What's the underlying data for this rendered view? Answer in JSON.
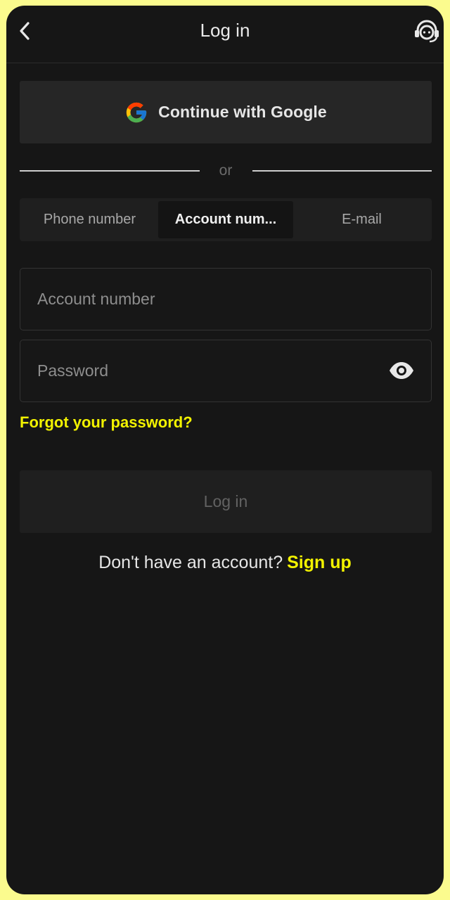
{
  "header": {
    "title": "Log in",
    "back_icon": "chevron-left-icon",
    "support_icon": "headset-support-icon"
  },
  "google": {
    "label": "Continue with Google",
    "icon": "google-g-icon"
  },
  "divider": {
    "text": "or"
  },
  "tabs": [
    {
      "label": "Phone number",
      "active": false
    },
    {
      "label": "Account num...",
      "active": true
    },
    {
      "label": "E-mail",
      "active": false
    }
  ],
  "form": {
    "account_placeholder": "Account number",
    "account_value": "",
    "password_placeholder": "Password",
    "password_value": "",
    "eye_icon": "eye-icon"
  },
  "forgot_label": "Forgot your password?",
  "login_label": "Log in",
  "signup": {
    "prompt": "Don't have an account?",
    "link": "Sign up"
  },
  "colors": {
    "accent": "#f2f200",
    "background": "#161616",
    "frame": "#fbfb8e"
  }
}
